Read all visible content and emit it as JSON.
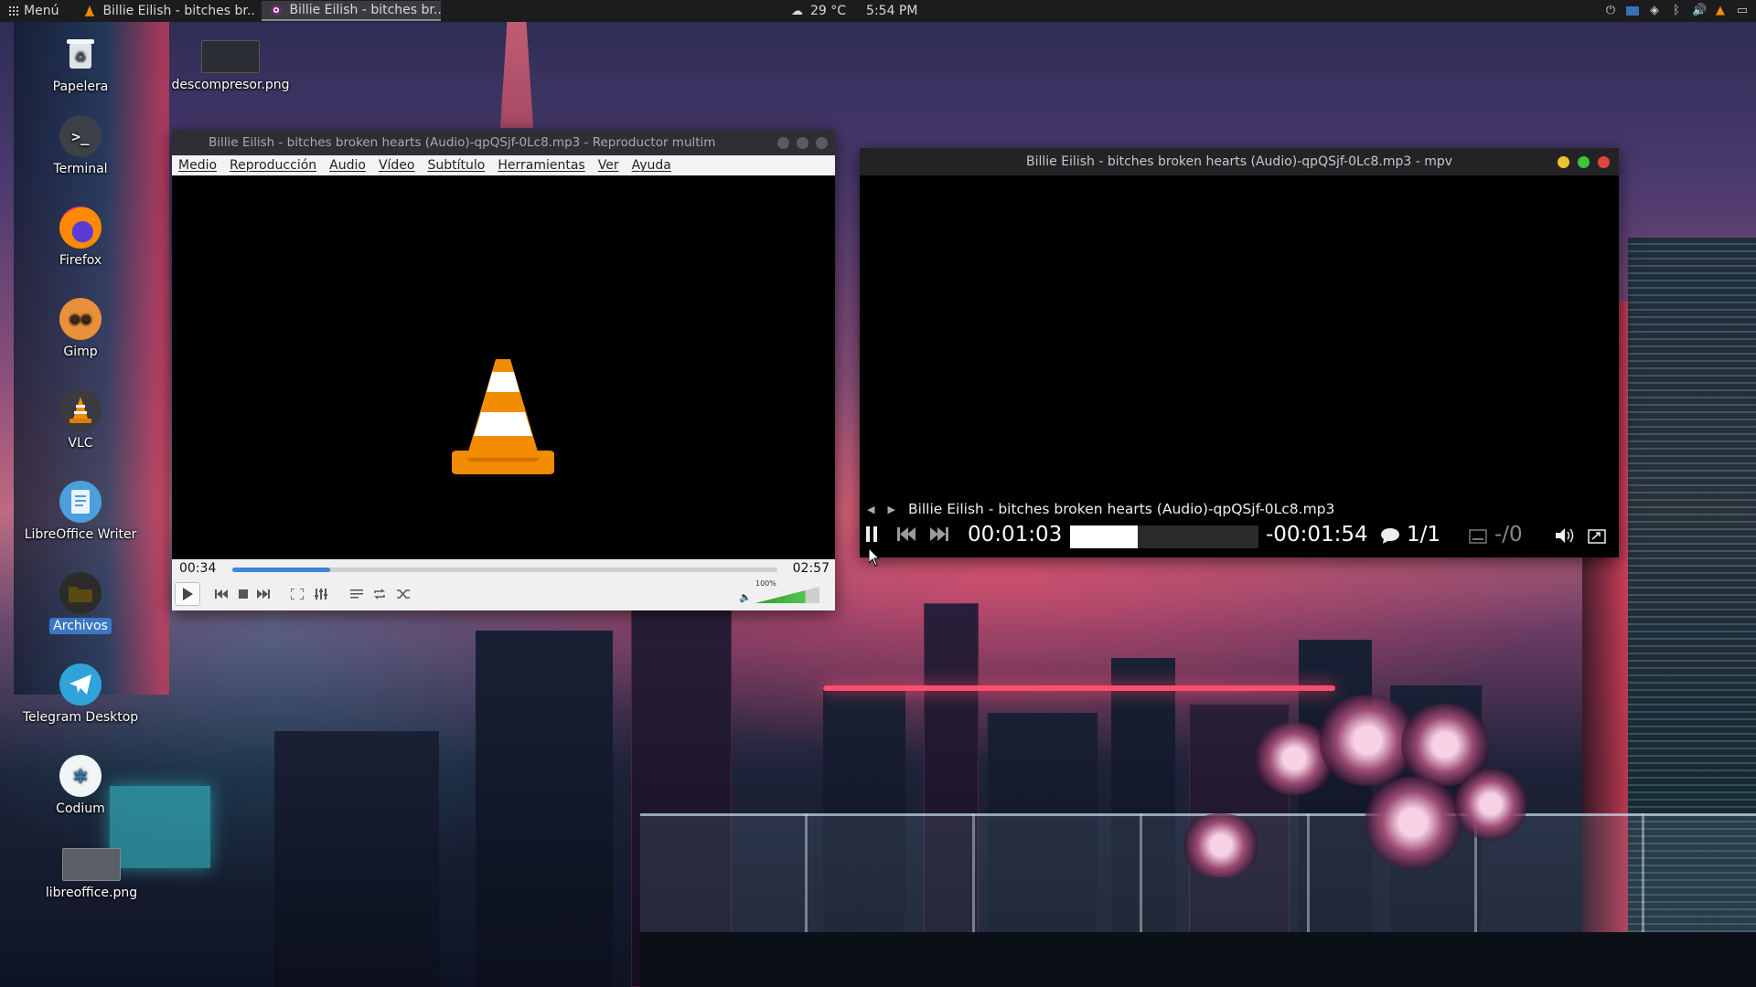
{
  "panel": {
    "menu_label": "Menú",
    "tasks": [
      {
        "label": "Billie Eilish - bitches br...",
        "icon": "vlc-cone-icon",
        "active": false
      },
      {
        "label": "Billie Eilish - bitches br...",
        "icon": "mpv-icon",
        "active": true
      }
    ],
    "weather": "29 °C",
    "clock": "5:54 PM"
  },
  "desktop": {
    "icons": [
      {
        "label": "Papelera",
        "icon": "trash-icon"
      },
      {
        "label": "descompresor.png",
        "icon": "image-file-icon"
      },
      {
        "label": "Terminal",
        "icon": "terminal-icon"
      },
      {
        "label": "Firefox",
        "icon": "firefox-icon"
      },
      {
        "label": "Gimp",
        "icon": "gimp-icon"
      },
      {
        "label": "VLC",
        "icon": "vlc-cone-icon"
      },
      {
        "label": "LibreOffice Writer",
        "icon": "writer-icon"
      },
      {
        "label": "Archivos",
        "icon": "folder-icon",
        "selected": true
      },
      {
        "label": "Telegram Desktop",
        "icon": "telegram-icon"
      },
      {
        "label": "Codium",
        "icon": "codium-icon"
      },
      {
        "label": "libreoffice.png",
        "icon": "image-file-icon"
      }
    ]
  },
  "vlc": {
    "title": "Billie Eilish - bitches broken hearts (Audio)-qpQSjf-0Lc8.mp3 - Reproductor multim",
    "menu": [
      "Medio",
      "Reproducción",
      "Audio",
      "Vídeo",
      "Subtítulo",
      "Herramientas",
      "Ver",
      "Ayuda"
    ],
    "elapsed": "00:34",
    "total": "02:57",
    "progress_fraction": 0.18,
    "volume_label": "100%",
    "volume_fraction": 0.78,
    "colors": {
      "accent": "#3b86d6",
      "cone_orange": "#f28c00"
    }
  },
  "mpv": {
    "title": "Billie Eilish - bitches broken hearts (Audio)-qpQSjf-0Lc8.mp3 - mpv",
    "media_title": "Billie Eilish - bitches broken hearts (Audio)-qpQSjf-0Lc8.mp3",
    "elapsed": "00:01:03",
    "remaining": "-00:01:54",
    "progress_fraction": 0.36,
    "audio_track": "1/1",
    "subtitle_track": "-/0",
    "colors": {
      "close": "#e0443e",
      "maximize": "#3cc23c",
      "minimize": "#e8c230"
    }
  }
}
